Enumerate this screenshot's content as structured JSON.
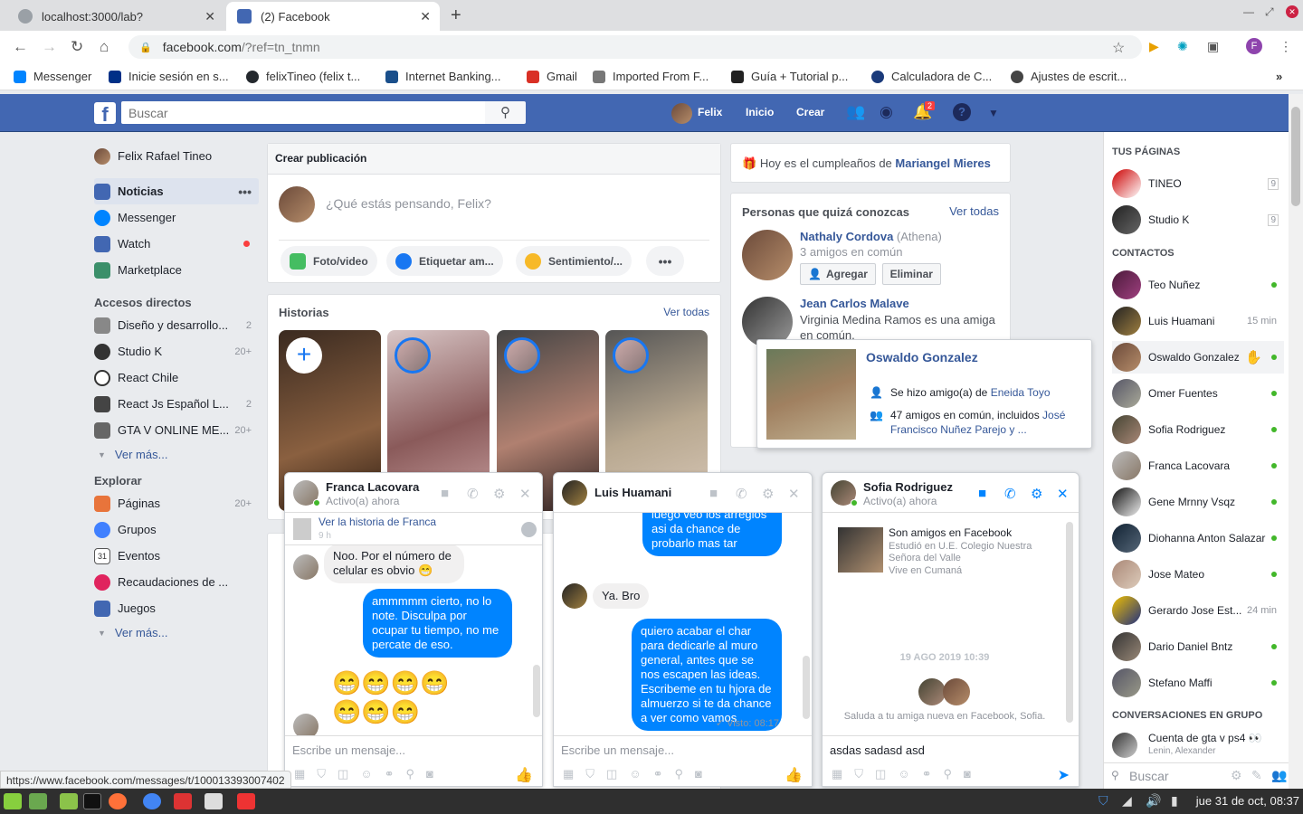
{
  "browser": {
    "tabs": [
      {
        "title": "localhost:3000/lab?"
      },
      {
        "title": "(2) Facebook"
      }
    ],
    "url_host": "facebook.com",
    "url_rest": "/?ref=tn_tnmn",
    "profile_letter": "F",
    "bookmarks": [
      {
        "label": "Messenger",
        "color": "#0084ff"
      },
      {
        "label": "Inicie sesión en s...",
        "color": "#003087"
      },
      {
        "label": "felixTineo (felix t...",
        "color": "#24292e"
      },
      {
        "label": "Internet Banking...",
        "color": "#1a4f8b"
      },
      {
        "label": "Gmail",
        "color": "#d93025"
      },
      {
        "label": "Imported From F...",
        "color": "#777777"
      },
      {
        "label": "Guía + Tutorial p...",
        "color": "#222222"
      },
      {
        "label": "Calculadora de C...",
        "color": "#1a3a7a"
      },
      {
        "label": "Ajustes de escrit...",
        "color": "#444444"
      }
    ]
  },
  "fb": {
    "search_placeholder": "Buscar",
    "user_short": "Felix",
    "nav_home": "Inicio",
    "nav_create": "Crear",
    "notif_count": "2",
    "brand": "#4267b2"
  },
  "left": {
    "profile_name": "Felix Rafael Tineo",
    "main": [
      {
        "label": "Noticias",
        "color": "#4267b2"
      },
      {
        "label": "Messenger",
        "color": "#0084ff"
      },
      {
        "label": "Watch",
        "color": "#4267b2"
      },
      {
        "label": "Marketplace",
        "color": "#3b8f6a"
      }
    ],
    "shortcuts_title": "Accesos directos",
    "shortcuts": [
      {
        "label": "Diseño y desarrollo...",
        "count": "2"
      },
      {
        "label": "Studio K",
        "count": "20+"
      },
      {
        "label": "React Chile",
        "count": ""
      },
      {
        "label": "React Js Español L...",
        "count": "2"
      },
      {
        "label": "GTA V ONLINE ME...",
        "count": "20+"
      }
    ],
    "see_more": "Ver más...",
    "explore_title": "Explorar",
    "explore": [
      {
        "label": "Páginas",
        "count": "20+",
        "color": "#e8743b"
      },
      {
        "label": "Grupos",
        "count": "",
        "color": "#4080ff"
      },
      {
        "label": "Eventos",
        "count": "",
        "color": "#555555"
      },
      {
        "label": "Recaudaciones de ...",
        "count": "",
        "color": "#e0245e"
      },
      {
        "label": "Juegos",
        "count": "",
        "color": "#4267b2"
      }
    ]
  },
  "composer": {
    "title": "Crear publicación",
    "placeholder": "¿Qué estás pensando, Felix?",
    "actions": [
      {
        "label": "Foto/video",
        "color": "#45bd62"
      },
      {
        "label": "Etiquetar am...",
        "color": "#1877f2"
      },
      {
        "label": "Sentimiento/...",
        "color": "#f7b928"
      }
    ]
  },
  "stories": {
    "title": "Historias",
    "see_all": "Ver todas"
  },
  "right": {
    "birthday_prefix": "Hoy es el cumpleaños de ",
    "birthday_name": "Mariangel Mieres",
    "pymk_title": "Personas que quizá conozcas",
    "pymk_see_all": "Ver todas",
    "p1_name": "Nathaly Cordova",
    "p1_extra": " (Athena)",
    "p1_mutual": "3 amigos en común",
    "add_btn": "Agregar",
    "remove_btn": "Eliminar",
    "p2_name": "Jean Carlos Malave",
    "p2_mutual": "Virginia Medina Ramos es una amiga en común."
  },
  "hovercard": {
    "name": "Oswaldo Gonzalez",
    "line1_prefix": "Se hizo amigo(a) de ",
    "line1_link": "Eneida Toyo",
    "line2_prefix": "47 amigos en común, incluidos ",
    "line2_link": "José Francisco Nuñez Parejo",
    "line2_suffix": " y ..."
  },
  "chats": {
    "franca": {
      "name": "Franca Lacovara",
      "status": "Activo(a) ahora",
      "story_link": "Ver la historia de Franca",
      "story_time": "9 h",
      "msg_in": "Noo. Por el número de celular es obvio 😁",
      "msg_out": "ammmmm cierto, no lo note. Disculpa por ocupar tu tiempo, no me percate de eso.",
      "emojis": "😁😁😁😁\n😁😁😁",
      "placeholder": "Escribe un mensaje..."
    },
    "luis": {
      "name": "Luis Huamani",
      "msg_top": "luego veo los arreglos asi da chance de probarlo mas tar",
      "msg_in": "Ya. Bro",
      "msg_out": "quiero acabar el char para dedicarle al muro general, antes que se nos escapen las ideas. Escribeme en tu hjora de almuerzo si te da chance a ver como vamos",
      "seen": "✓ Visto: 08:17",
      "placeholder": "Escribe un mensaje..."
    },
    "sofia": {
      "name": "Sofia Rodriguez",
      "status": "Activo(a) ahora",
      "friends": "Son amigos en Facebook",
      "study": "Estudió en U.E. Colegio Nuestra Señora del Valle",
      "lives": "Vive en Cumaná",
      "date": "19 AGO 2019 10:39",
      "greet": "Saluda a tu amiga nueva en Facebook, Sofia.",
      "typed": "asdas  sadasd asd"
    }
  },
  "sidebar": {
    "pages_title": "TUS PÁGINAS",
    "pages": [
      {
        "name": "TINEO",
        "count": "9"
      },
      {
        "name": "Studio K",
        "count": "9"
      }
    ],
    "contacts_title": "CONTACTOS",
    "contacts": [
      {
        "name": "Teo Nuñez",
        "time": ""
      },
      {
        "name": "Luis Huamani",
        "time": "15 min"
      },
      {
        "name": "Oswaldo Gonzalez",
        "time": ""
      },
      {
        "name": "Omer Fuentes",
        "time": ""
      },
      {
        "name": "Sofia Rodriguez",
        "time": ""
      },
      {
        "name": "Franca Lacovara",
        "time": ""
      },
      {
        "name": "Gene Mrnny Vsqz",
        "time": ""
      },
      {
        "name": "Diohanna Anton Salazar",
        "time": ""
      },
      {
        "name": "Jose Mateo",
        "time": ""
      },
      {
        "name": "Gerardo Jose Est...",
        "time": "24 min"
      },
      {
        "name": "Dario Daniel Bntz",
        "time": ""
      },
      {
        "name": "Stefano Maffi",
        "time": ""
      }
    ],
    "groups_title": "CONVERSACIONES EN GRUPO",
    "group_name": "Cuenta de gta v ps4 👀",
    "group_members": "Lenin, Alexander",
    "search_placeholder": "Buscar"
  },
  "status_url": "https://www.facebook.com/messages/t/100013393007402",
  "clock": "jue 31 de oct, 08:37"
}
